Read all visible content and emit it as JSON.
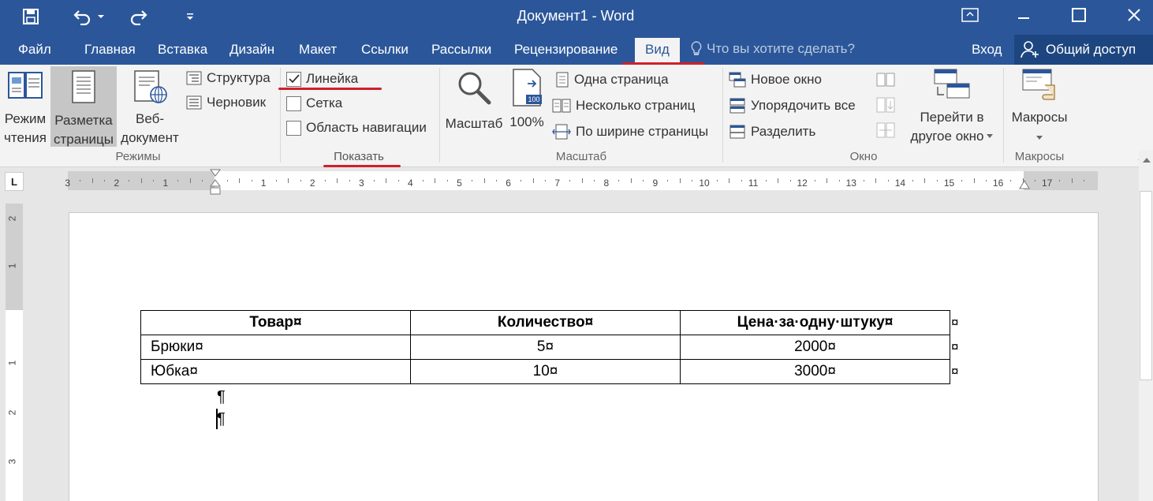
{
  "window": {
    "title": "Документ1 - Word"
  },
  "tabs": [
    {
      "label": "Файл"
    },
    {
      "label": "Главная"
    },
    {
      "label": "Вставка"
    },
    {
      "label": "Дизайн"
    },
    {
      "label": "Макет"
    },
    {
      "label": "Ссылки"
    },
    {
      "label": "Рассылки"
    },
    {
      "label": "Рецензирование"
    },
    {
      "label": "Вид"
    }
  ],
  "tell_me": "Что вы хотите сделать?",
  "account": {
    "signin": "Вход",
    "share": "Общий доступ"
  },
  "ribbon": {
    "modes": {
      "read_l1": "Режим",
      "read_l2": "чтения",
      "layout_l1": "Разметка",
      "layout_l2": "страницы",
      "web_l1": "Веб-",
      "web_l2": "документ",
      "outline": "Структура",
      "draft": "Черновик",
      "group": "Режимы"
    },
    "show": {
      "ruler": "Линейка",
      "ruler_checked": true,
      "grid": "Сетка",
      "grid_checked": false,
      "nav": "Область навигации",
      "nav_checked": false,
      "group": "Показать"
    },
    "zoom": {
      "zoom": "Масштаб",
      "hundred": "100%",
      "hundred_badge": "100",
      "one_page": "Одна страница",
      "multi_page": "Несколько страниц",
      "page_width": "По ширине страницы",
      "group": "Масштаб"
    },
    "window": {
      "new_window": "Новое окно",
      "arrange": "Упорядочить все",
      "split": "Разделить",
      "switch_l1": "Перейти в",
      "switch_l2": "другое окно",
      "group": "Окно"
    },
    "macros": {
      "macros": "Макросы",
      "group": "Макросы"
    }
  },
  "ruler": {
    "corner": "L",
    "labels": [
      "3",
      "2",
      "1",
      "1",
      "2",
      "3",
      "4",
      "5",
      "6",
      "7",
      "8",
      "9",
      "10",
      "11",
      "12",
      "13",
      "14",
      "15",
      "16",
      "17"
    ],
    "vlabels": [
      "2",
      "1",
      "1",
      "2",
      "3"
    ]
  },
  "document": {
    "headers": [
      "Товар¤",
      "Количество¤",
      "Цена·за·одну·штуку¤"
    ],
    "rows": [
      [
        "Брюки¤",
        "5¤",
        "2000¤"
      ],
      [
        "Юбка¤",
        "10¤",
        "3000¤"
      ]
    ],
    "end_of_row": "¤",
    "pilcrow": "¶"
  }
}
